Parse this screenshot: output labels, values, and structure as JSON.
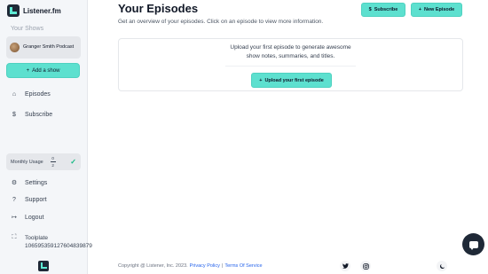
{
  "brand": {
    "name": "Listener.fm",
    "logo_icon": "listener-logo"
  },
  "sidebar": {
    "shows_label": "Your Shows",
    "show": {
      "name": "Granger Smith Podcast",
      "avatar": "podcast-avatar"
    },
    "add_show_label": "Add a show",
    "nav": [
      {
        "label": "Episodes",
        "icon": "home-icon",
        "glyph": "⌂"
      },
      {
        "label": "Subscribe",
        "icon": "dollar-icon",
        "glyph": "$"
      }
    ],
    "usage": {
      "label": "Monthly Usage",
      "used": "0",
      "total": "2",
      "check": "✓"
    },
    "bottom_nav": [
      {
        "label": "Settings",
        "icon": "gear-icon",
        "glyph": "⚙"
      },
      {
        "label": "Support",
        "icon": "help-icon",
        "glyph": "?"
      },
      {
        "label": "Logout",
        "icon": "logout-icon",
        "glyph": "↦"
      }
    ],
    "user": {
      "name": "Toolplate",
      "id": "106595359127604839879",
      "icon": "user-icon",
      "glyph": "⛶"
    }
  },
  "header": {
    "title": "Your Episodes",
    "subtitle": "Get an overview of your episodes. Click on an episode to view more information.",
    "subscribe_label": "Subscribe",
    "new_episode_label": "New Episode"
  },
  "empty_state": {
    "line1": "Upload your first episode to generate awesome",
    "line2": "show notes, summaries, and titles.",
    "button_label": "Upload your first episode"
  },
  "footer": {
    "copyright": "Copyright @ Listener, Inc. 2023.",
    "privacy": "Privacy Policy",
    "separator": "|",
    "terms": "Terms Of Service"
  },
  "colors": {
    "accent": "#5de0cf",
    "sidebar_bg": "#f4f6f9",
    "chat_bg": "#1f2937"
  }
}
